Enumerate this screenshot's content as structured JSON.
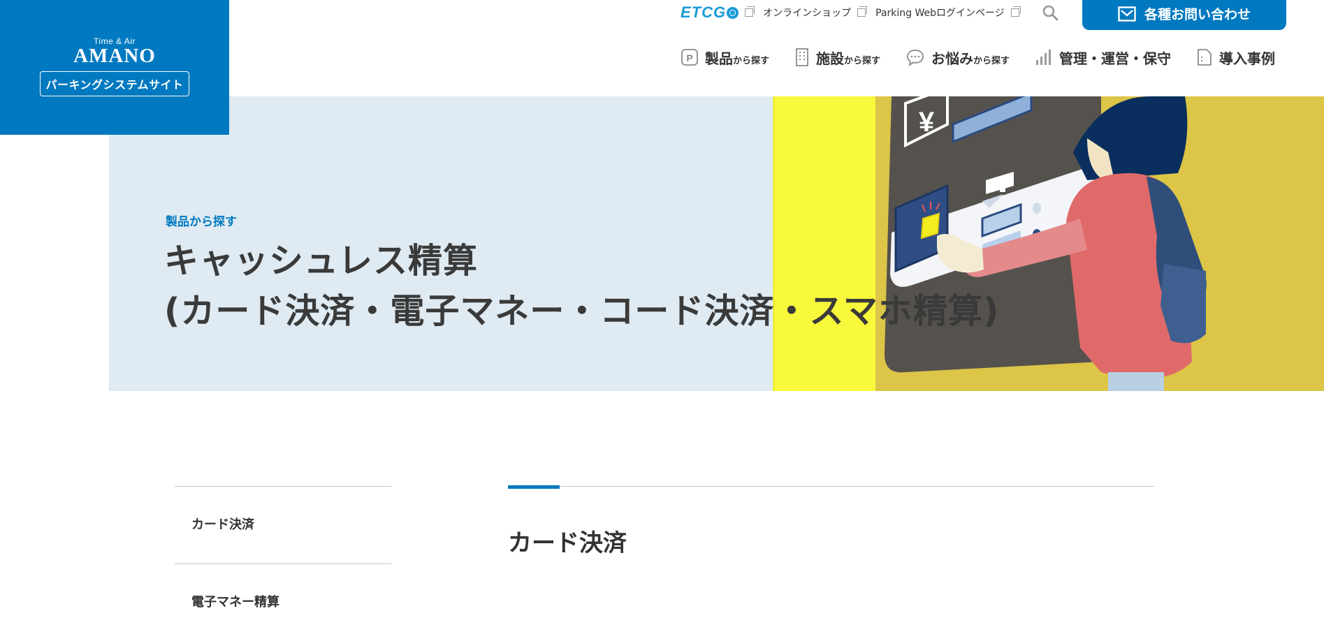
{
  "logo": {
    "tagline": "Time & Air",
    "brand": "AMANO",
    "site_label": "パーキングシステムサイト"
  },
  "utility": {
    "etcgo": "ETCG",
    "online_shop": "オンラインショップ",
    "parking_login": "Parking Webログインページ",
    "contact_label": "各種お問い合わせ"
  },
  "nav": [
    {
      "label": "製品",
      "suffix": "から探す",
      "icon": "parking-icon"
    },
    {
      "label": "施設",
      "suffix": "から探す",
      "icon": "building-icon"
    },
    {
      "label": "お悩み",
      "suffix": "から探す",
      "icon": "speech-bubble-icon"
    },
    {
      "label": "管理・運営・保守",
      "suffix": "",
      "icon": "bar-chart-icon"
    },
    {
      "label": "導入事例",
      "suffix": "",
      "icon": "document-icon"
    }
  ],
  "hero": {
    "breadcrumb": "製品から探す",
    "title_line1": "キャッシュレス精算",
    "title_line2": "(カード決済・電子マネー・コード決済・スマホ精算)"
  },
  "sidebar": {
    "items": [
      "カード決済",
      "電子マネー精算"
    ]
  },
  "section": {
    "title": "カード決済"
  },
  "colors": {
    "brand": "#0079c0",
    "hero_bg": "#dfeaf2",
    "accent_yellow": "#f8f83c"
  }
}
